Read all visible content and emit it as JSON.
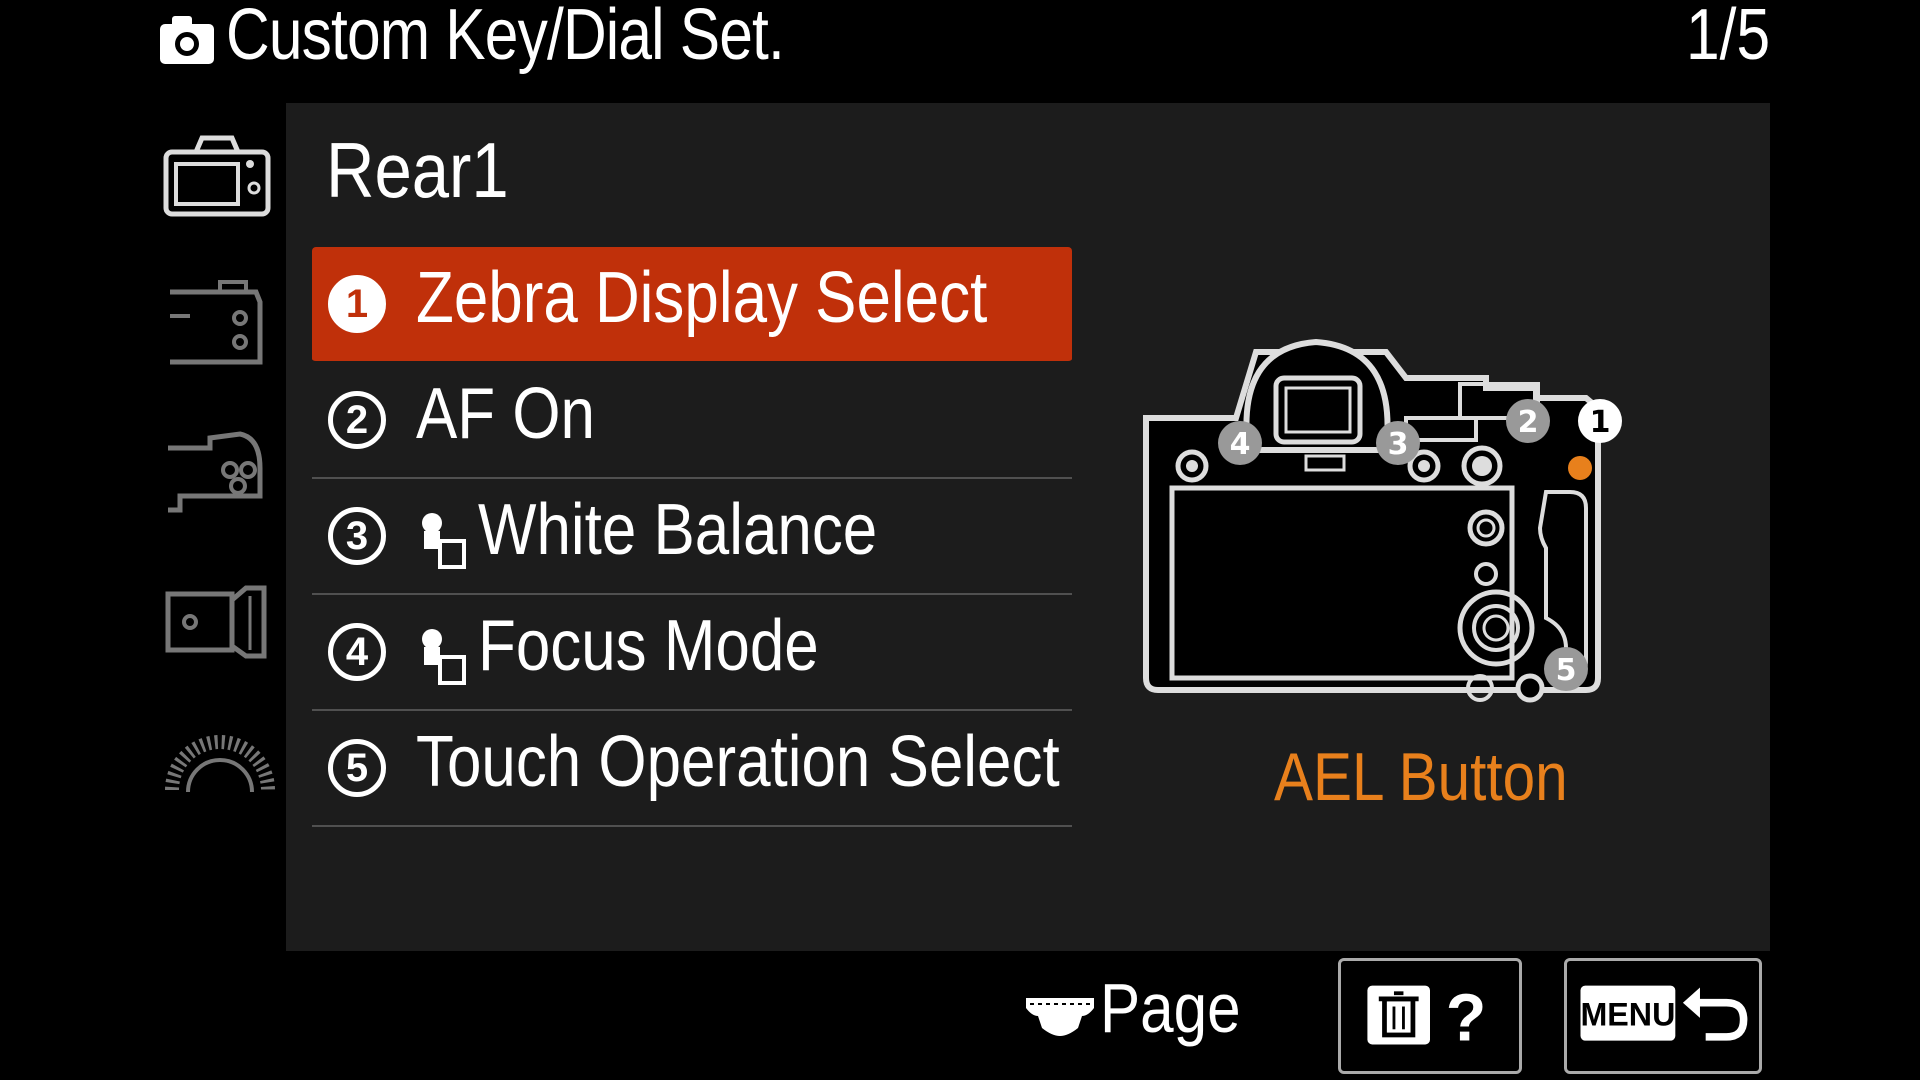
{
  "header": {
    "title": "Custom Key/Dial Set.",
    "page_indicator": "1/5",
    "icon": "camera-icon"
  },
  "side_tabs": [
    {
      "name": "rear-camera-tab",
      "icon": "camera-rear-icon",
      "selected": true
    },
    {
      "name": "right-side-tab",
      "icon": "camera-side-right-icon",
      "selected": false
    },
    {
      "name": "grip-tab",
      "icon": "camera-grip-icon",
      "selected": false
    },
    {
      "name": "lens-tab",
      "icon": "camera-lens-side-icon",
      "selected": false
    },
    {
      "name": "dial-tab",
      "icon": "dial-icon",
      "selected": false
    }
  ],
  "main": {
    "group_title": "Rear1",
    "items": [
      {
        "number": "1",
        "label": "Zebra Display Select",
        "has_assign_icon": false,
        "selected": true
      },
      {
        "number": "2",
        "label": "AF On",
        "has_assign_icon": false,
        "selected": false
      },
      {
        "number": "3",
        "label": "White Balance",
        "has_assign_icon": true,
        "selected": false
      },
      {
        "number": "4",
        "label": "Focus Mode",
        "has_assign_icon": true,
        "selected": false
      },
      {
        "number": "5",
        "label": "Touch Operation Select",
        "has_assign_icon": false,
        "selected": false
      }
    ],
    "diagram": {
      "button_labels": [
        "1",
        "2",
        "3",
        "4",
        "5"
      ],
      "highlight_color": "#e8801c"
    },
    "selected_function_name": "AEL Button"
  },
  "footer": {
    "page_label": "Page",
    "help_label": "?",
    "menu_label": "MENU"
  },
  "colors": {
    "accent": "#c0300a",
    "function_text": "#e8801c",
    "panel": "#1c1c1c"
  }
}
